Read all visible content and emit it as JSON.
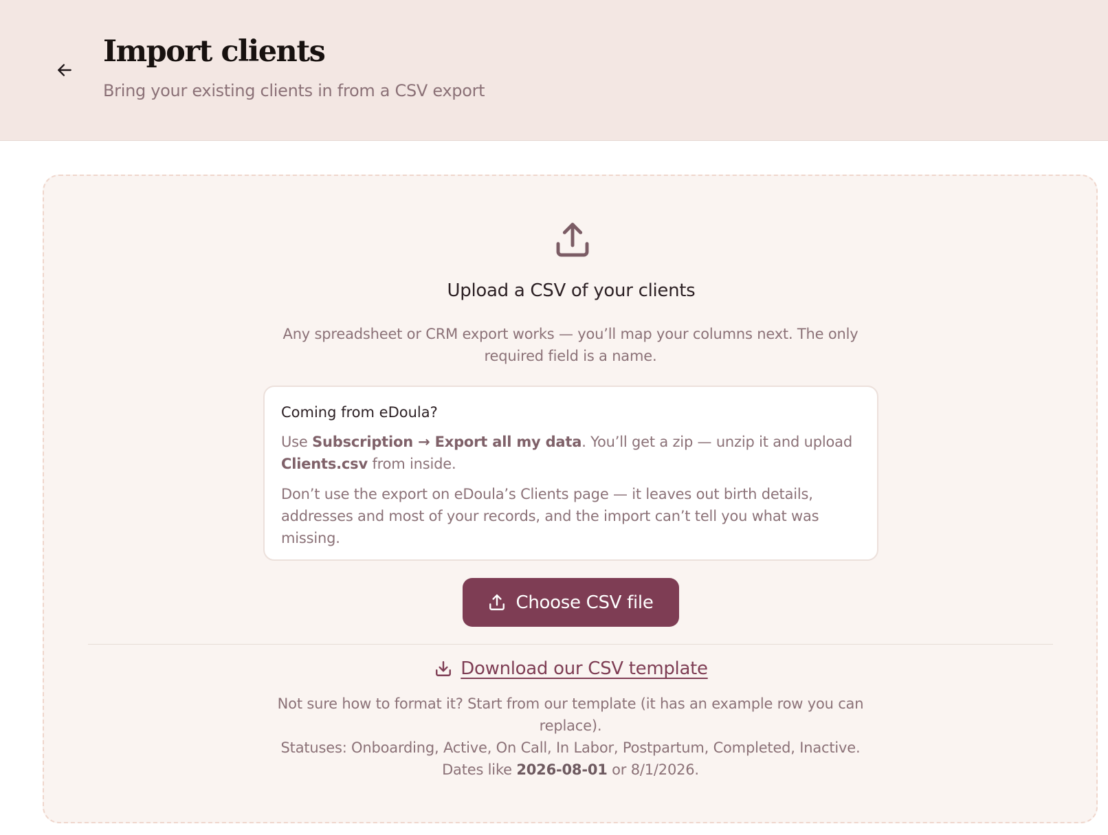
{
  "header": {
    "back_icon": "arrow-left-icon",
    "title": "Import clients",
    "subtitle": "Bring your existing clients in from a CSV export"
  },
  "upload": {
    "icon": "upload-icon",
    "heading": "Upload a CSV of your clients",
    "description": "Any spreadsheet or CRM export works — you’ll map your columns next. The only required field is a name."
  },
  "edoula_box": {
    "title": "Coming from eDoula?",
    "p1_use": "Use ",
    "p1_path": "Subscription → Export all my data",
    "p1_mid": ". You’ll get a zip — unzip it and upload ",
    "p1_file": "Clients.csv",
    "p1_end": " from inside.",
    "p2": "Don’t use the export on eDoula’s Clients page — it leaves out birth details, addresses and most of your records, and the import can’t tell you what was missing."
  },
  "choose_button": {
    "label": "Choose CSV file",
    "icon": "upload-icon"
  },
  "template": {
    "icon": "download-icon",
    "link_label": "Download our CSV template",
    "note": "Not sure how to format it? Start from our template (it has an example row you can replace).",
    "statuses": "Statuses: Onboarding, Active, On Call, In Labor, Postpartum, Completed, Inactive.",
    "dates_prefix": "Dates like ",
    "dates_example": "2026-08-01",
    "dates_suffix": " or 8/1/2026."
  },
  "colors": {
    "header_bg": "#f3e7e3",
    "dropzone_bg": "#faf4f1",
    "accent": "#7e3d54",
    "muted_text": "#8b7177"
  }
}
